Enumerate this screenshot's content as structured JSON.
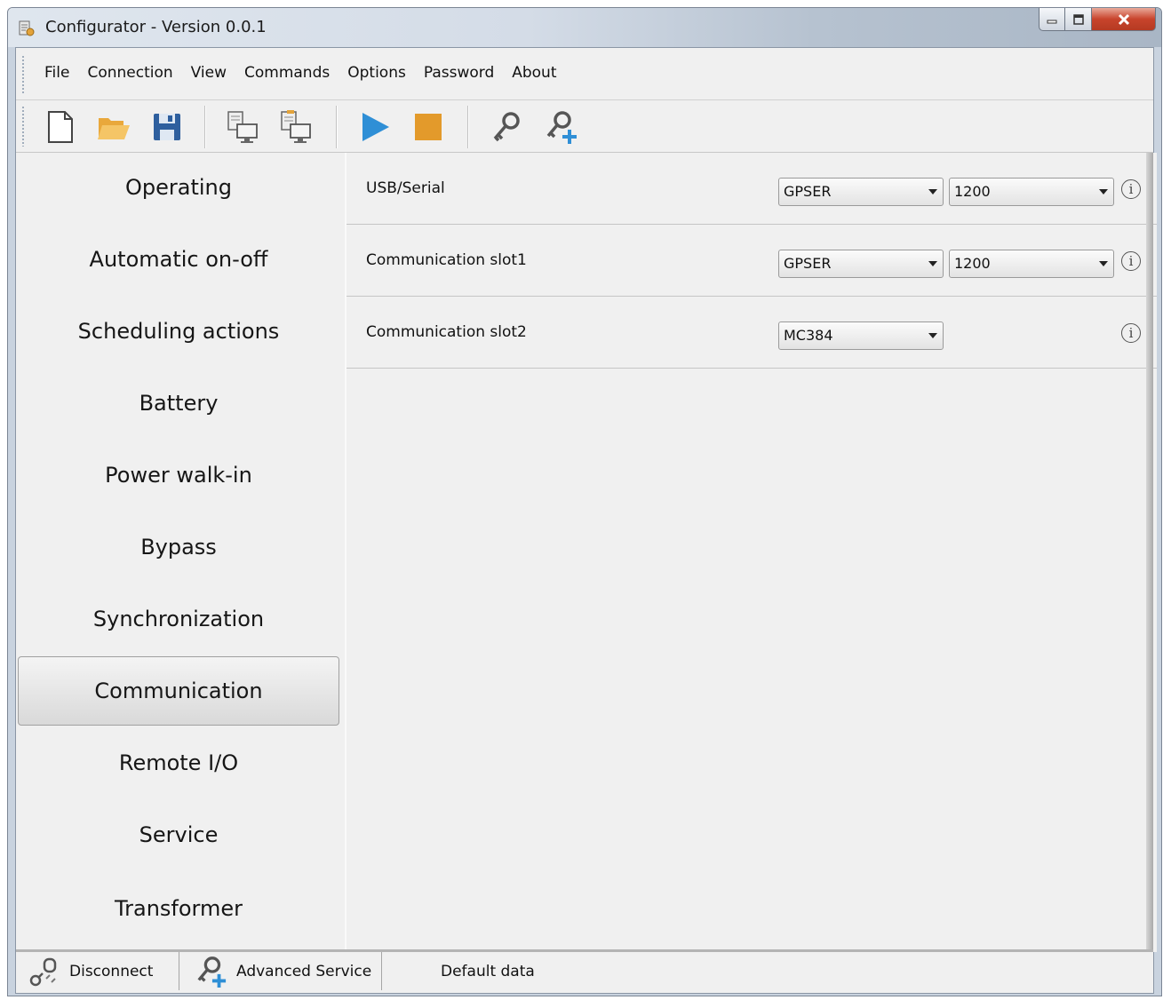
{
  "window": {
    "title": "Configurator - Version 0.0.1"
  },
  "menu": [
    "File",
    "Connection",
    "View",
    "Commands",
    "Options",
    "Password",
    "About"
  ],
  "toolbar": {
    "icons": [
      "new-file-icon",
      "open-folder-icon",
      "save-icon",
      "read-device-icon",
      "write-device-icon",
      "play-icon",
      "stop-icon",
      "key-icon",
      "add-user-key-icon"
    ]
  },
  "sidebar": {
    "items": [
      {
        "label": "Operating"
      },
      {
        "label": "Automatic on-off"
      },
      {
        "label": "Scheduling actions"
      },
      {
        "label": "Battery"
      },
      {
        "label": "Power walk-in"
      },
      {
        "label": "Bypass"
      },
      {
        "label": "Synchronization"
      },
      {
        "label": "Communication",
        "active": true
      },
      {
        "label": "Remote I/O"
      },
      {
        "label": "Service"
      },
      {
        "label": "Transformer"
      }
    ]
  },
  "main": {
    "rows": [
      {
        "label": "USB/Serial",
        "protocol": "GPSER",
        "baud": "1200"
      },
      {
        "label": "Communication slot1",
        "protocol": "GPSER",
        "baud": "1200"
      },
      {
        "label": "Communication slot2",
        "protocol": "MC384"
      }
    ]
  },
  "statusbar": {
    "disconnect": "Disconnect",
    "advanced_service": "Advanced Service",
    "info": "Default data"
  },
  "colors": {
    "play": "#2f8fd6",
    "stop": "#e39a2b",
    "folder": "#f0b64a",
    "save": "#2e5f9e"
  }
}
